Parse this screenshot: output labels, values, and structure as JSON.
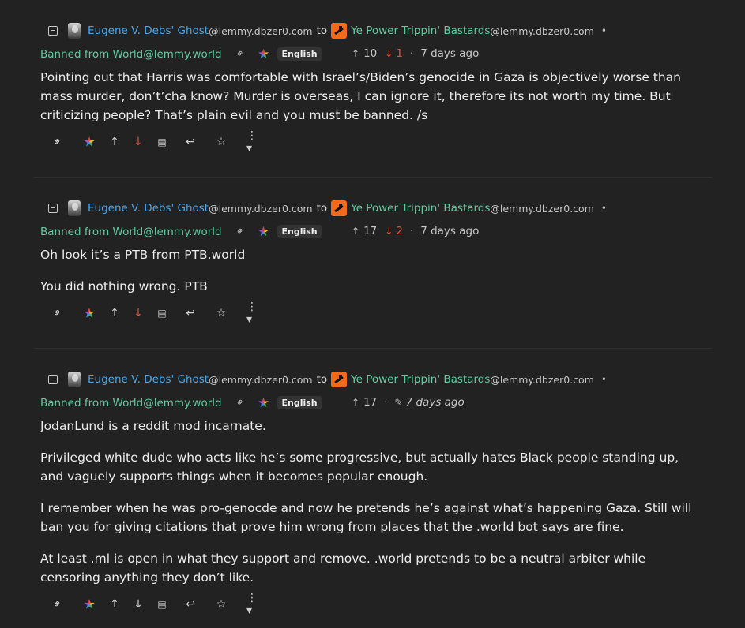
{
  "comments": [
    {
      "user": "Eugene V. Debs' Ghost",
      "user_instance": "@lemmy.dbzer0.com",
      "to": "to",
      "community": "Ye Power Trippin' Bastards",
      "community_instance": "@lemmy.dbzer0.com",
      "dot": "•",
      "flair": "Banned from World@lemmy.world",
      "language": "English",
      "upvotes": "10",
      "downvotes": "1",
      "sep": "·",
      "time": "7 days ago",
      "paragraphs": [
        "Pointing out that Harris was comfortable with Israel’s/Biden’s genocide in Gaza is objectively worse than mass murder, don’t’cha know? Murder is overseas, I can ignore it, therefore its not worth my time. But criticizing people? That’s plain evil and you must be banned. /s"
      ]
    },
    {
      "user": "Eugene V. Debs' Ghost",
      "user_instance": "@lemmy.dbzer0.com",
      "to": "to",
      "community": "Ye Power Trippin' Bastards",
      "community_instance": "@lemmy.dbzer0.com",
      "dot": "•",
      "flair": "Banned from World@lemmy.world",
      "language": "English",
      "upvotes": "17",
      "downvotes": "2",
      "sep": "·",
      "time": "7 days ago",
      "paragraphs": [
        "Oh look it’s a PTB from PTB.world",
        "You did nothing wrong. PTB"
      ]
    },
    {
      "user": "Eugene V. Debs' Ghost",
      "user_instance": "@lemmy.dbzer0.com",
      "to": "to",
      "community": "Ye Power Trippin' Bastards",
      "community_instance": "@lemmy.dbzer0.com",
      "dot": "•",
      "flair": "Banned from World@lemmy.world",
      "language": "English",
      "upvotes": "17",
      "sep": "·",
      "time": "7 days ago",
      "paragraphs": [
        "JodanLund is a reddit mod incarnate.",
        "Privileged white dude who acts like he’s some progressive, but actually hates Black people standing up, and vaguely supports things when it becomes popular enough.",
        "I remember when he was pro-genocde and now he pretends he’s against what’s happening Gaza. Still will ban you for giving citations that prove him wrong from places that the .world bot says are fine.",
        "At least .ml is open in what they support and remove. .world pretends to be a neutral arbiter while censoring anything they don’t like."
      ]
    }
  ],
  "icons": {
    "collapse": "minus-square-icon",
    "link": "link-icon",
    "up": "arrow-up-icon",
    "down": "arrow-down-icon",
    "source": "document-icon",
    "reply": "reply-icon",
    "favorite": "star-icon",
    "more": "more-dots-icon"
  },
  "glyphs": {
    "up": "↑",
    "down": "↓",
    "link": "⚭",
    "source": "▤",
    "reply": "↩",
    "fav": "☆",
    "more": "⋮ ▾",
    "pencil": "✎"
  },
  "colors": {
    "background": "#222222",
    "user": "#4ea6e6",
    "community": "#62c9a1",
    "downvote": "#e2543e",
    "community_icon": "#f26a1b"
  }
}
